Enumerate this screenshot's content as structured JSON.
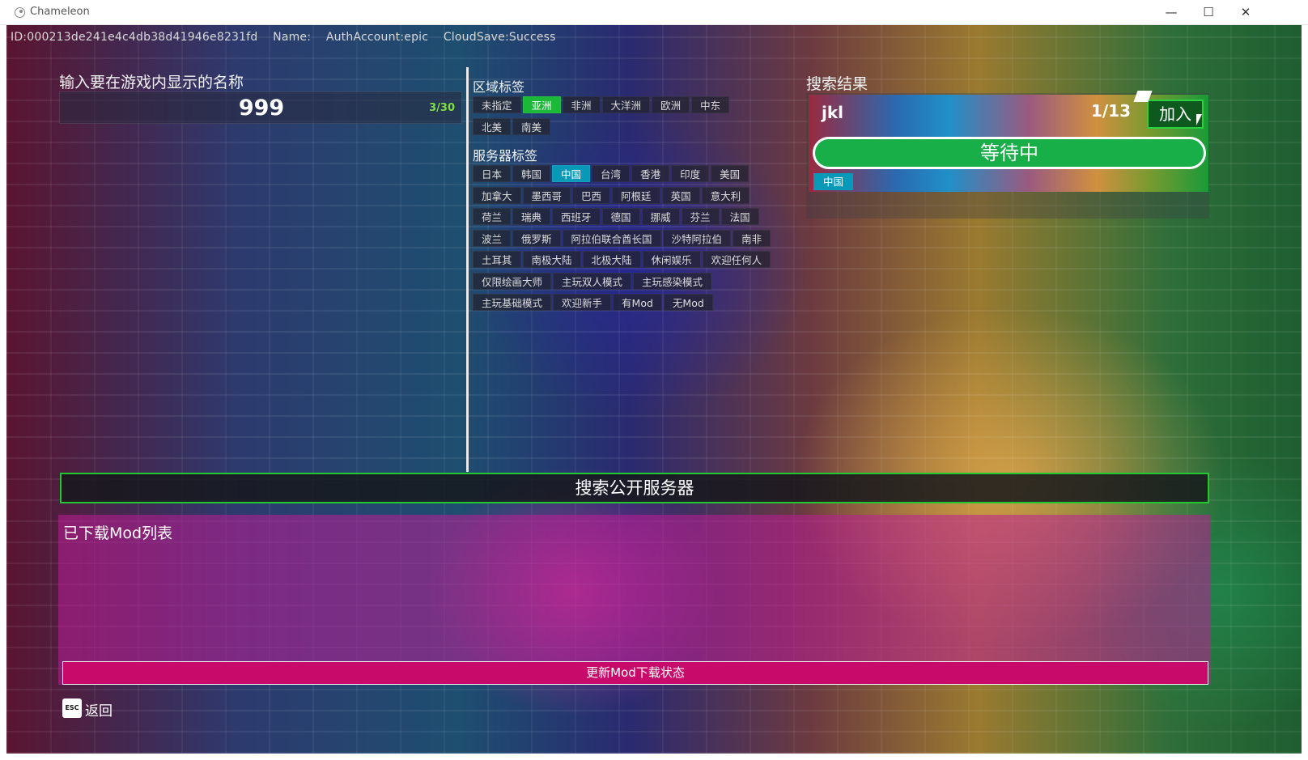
{
  "window": {
    "title": "Chameleon",
    "minimize": "—",
    "maximize": "☐",
    "close": "✕"
  },
  "status": {
    "id": "ID:000213de241e4c4db38d41946e8231fd",
    "name": "Name:",
    "auth": "AuthAccount:epic",
    "cloud": "CloudSave:Success"
  },
  "name_input": {
    "label": "输入要在游戏内显示的名称",
    "value": "999",
    "count": "3/30"
  },
  "region": {
    "label": "区域标签",
    "rows": [
      [
        {
          "label": "未指定"
        },
        {
          "label": "亚洲",
          "selected": true
        },
        {
          "label": "非洲"
        },
        {
          "label": "大洋洲"
        },
        {
          "label": "欧洲"
        },
        {
          "label": "中东"
        }
      ],
      [
        {
          "label": "北美"
        },
        {
          "label": "南美"
        }
      ]
    ]
  },
  "server": {
    "label": "服务器标签",
    "rows": [
      [
        {
          "label": "日本"
        },
        {
          "label": "韩国"
        },
        {
          "label": "中国",
          "selected": true
        },
        {
          "label": "台湾"
        },
        {
          "label": "香港"
        },
        {
          "label": "印度"
        },
        {
          "label": "美国"
        }
      ],
      [
        {
          "label": "加拿大"
        },
        {
          "label": "墨西哥"
        },
        {
          "label": "巴西"
        },
        {
          "label": "阿根廷"
        },
        {
          "label": "英国"
        },
        {
          "label": "意大利"
        }
      ],
      [
        {
          "label": "荷兰"
        },
        {
          "label": "瑞典"
        },
        {
          "label": "西班牙"
        },
        {
          "label": "德国"
        },
        {
          "label": "挪威"
        },
        {
          "label": "芬兰"
        },
        {
          "label": "法国"
        }
      ],
      [
        {
          "label": "波兰"
        },
        {
          "label": "俄罗斯"
        },
        {
          "label": "阿拉伯联合酋长国"
        },
        {
          "label": "沙特阿拉伯"
        },
        {
          "label": "南非"
        }
      ],
      [
        {
          "label": "土耳其"
        },
        {
          "label": "南极大陆"
        },
        {
          "label": "北极大陆"
        },
        {
          "label": "休闲娱乐"
        },
        {
          "label": "欢迎任何人"
        }
      ],
      [
        {
          "label": "仅限绘画大师"
        },
        {
          "label": "主玩双人模式"
        },
        {
          "label": "主玩感染模式"
        }
      ],
      [
        {
          "label": "主玩基础模式"
        },
        {
          "label": "欢迎新手"
        },
        {
          "label": "有Mod"
        },
        {
          "label": "无Mod"
        }
      ]
    ]
  },
  "results": {
    "label": "搜索结果",
    "item": {
      "name": "jkl",
      "count": "1/13",
      "join": "加入",
      "status": "等待中",
      "tag": "中国"
    }
  },
  "search_button": "搜索公开服务器",
  "mods": {
    "label": "已下载Mod列表",
    "update_button": "更新Mod下载状态"
  },
  "back": {
    "key": "ESC",
    "label": "返回"
  },
  "colors": {
    "accent_green": "#1bb83a",
    "accent_teal": "#0898b8",
    "mod_pink": "#c80a6a"
  }
}
